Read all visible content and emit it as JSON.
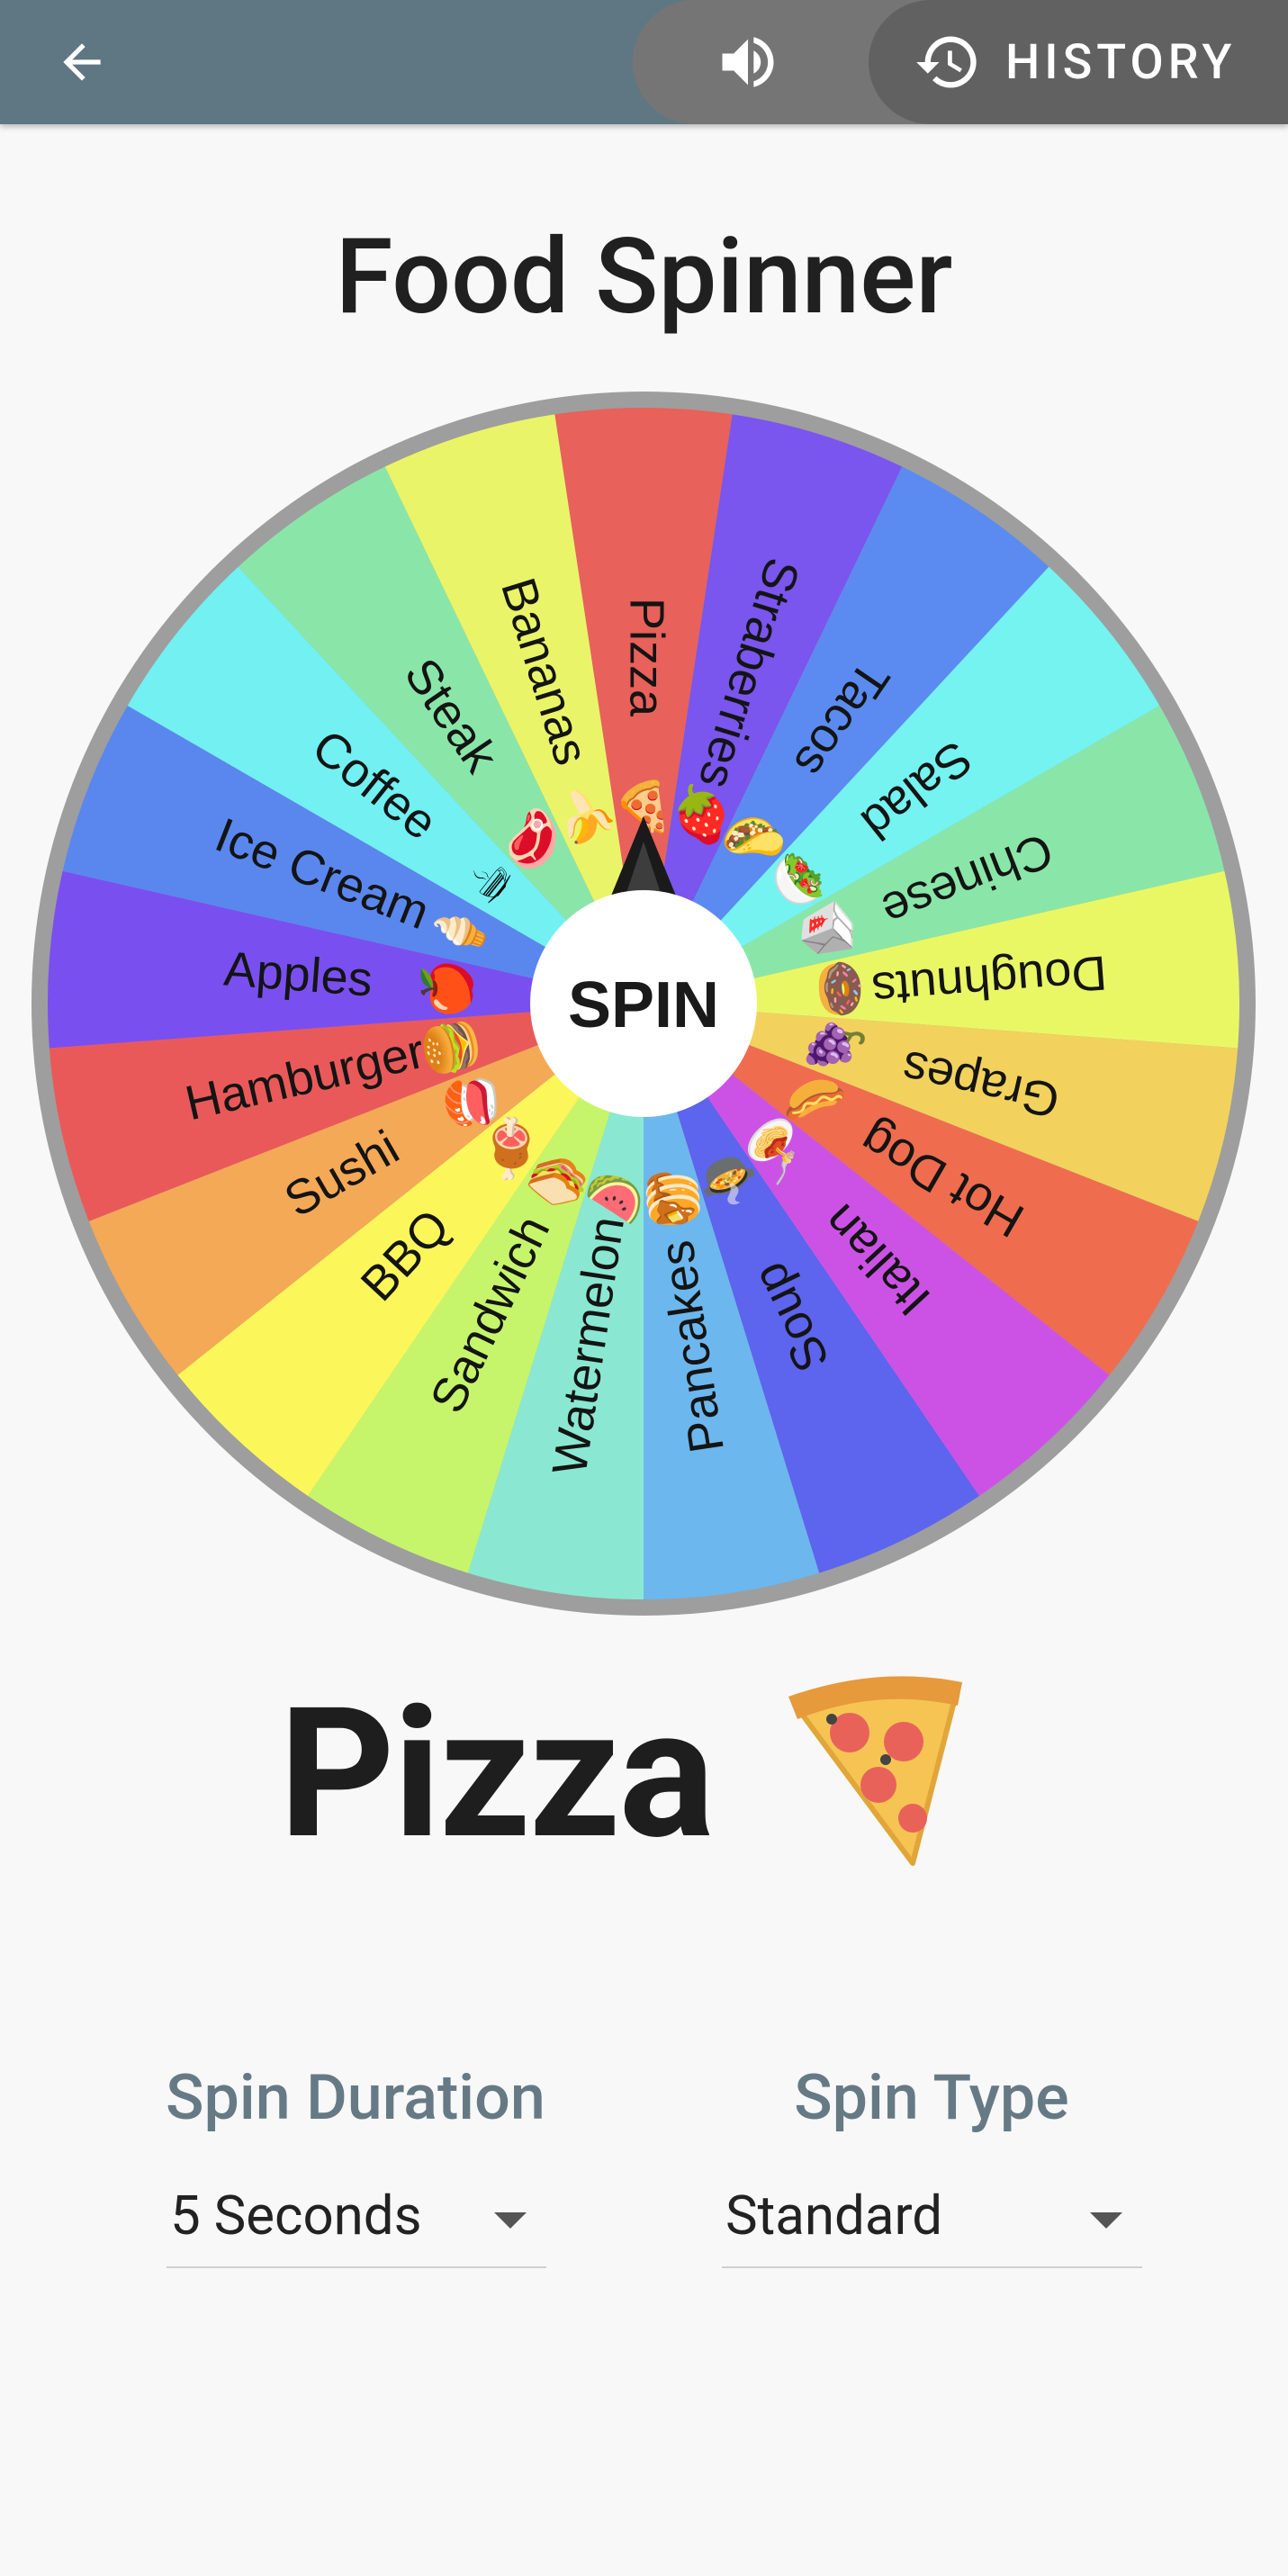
{
  "appbar": {
    "back_icon": "arrow-left-icon",
    "sound_icon": "volume-icon",
    "history_icon": "history-icon",
    "history_label": "HISTORY",
    "colors": {
      "bar": "#5f7783",
      "pill_sound": "#757575",
      "pill_history": "#616161"
    }
  },
  "page": {
    "title": "Food Spinner"
  },
  "wheel": {
    "center_label": "SPIN",
    "segments": [
      {
        "label": "Pizza",
        "emoji": "🍕",
        "color": "#e8615a"
      },
      {
        "label": "Straberries",
        "emoji": "🍓",
        "color": "#7a55ee"
      },
      {
        "label": "Tacos",
        "emoji": "🌮",
        "color": "#5b8bf0"
      },
      {
        "label": "Salad",
        "emoji": "🥗",
        "color": "#74f3f0"
      },
      {
        "label": "Chinese",
        "emoji": "🥡",
        "color": "#8ae6a8"
      },
      {
        "label": "Doughnuts",
        "emoji": "🍩",
        "color": "#eaf765"
      },
      {
        "label": "Grapes",
        "emoji": "🍇",
        "color": "#f2d25c"
      },
      {
        "label": "Hot Dog",
        "emoji": "🌭",
        "color": "#f06c4f"
      },
      {
        "label": "Italian",
        "emoji": "🍝",
        "color": "#cc52e6"
      },
      {
        "label": "Soup",
        "emoji": "🍲",
        "color": "#5d64ee"
      },
      {
        "label": "Pancakes",
        "emoji": "🥞",
        "color": "#6cb7ee"
      },
      {
        "label": "Watermelon",
        "emoji": "🍉",
        "color": "#8ae8d2"
      },
      {
        "label": "Sandwich",
        "emoji": "🥪",
        "color": "#c6f56c"
      },
      {
        "label": "BBQ",
        "emoji": "🍖",
        "color": "#fbf75a"
      },
      {
        "label": "Sushi",
        "emoji": "🍣",
        "color": "#f4a957"
      },
      {
        "label": "Hamburger",
        "emoji": "🍔",
        "color": "#ea5959"
      },
      {
        "label": "Apples",
        "emoji": "🍎",
        "color": "#7a4ff0"
      },
      {
        "label": "Ice Cream",
        "emoji": "🍦",
        "color": "#5a87ee"
      },
      {
        "label": "Coffee",
        "emoji": "☕",
        "color": "#72f0f2"
      },
      {
        "label": "Steak",
        "emoji": "🥩",
        "color": "#8ae6a8"
      },
      {
        "label": "Bananas",
        "emoji": "🍌",
        "color": "#eaf468"
      }
    ]
  },
  "result": {
    "label": "Pizza",
    "emoji": "🍕"
  },
  "settings": {
    "spin_duration": {
      "label": "Spin Duration",
      "value": "5 Seconds"
    },
    "spin_type": {
      "label": "Spin Type",
      "value": "Standard"
    }
  }
}
